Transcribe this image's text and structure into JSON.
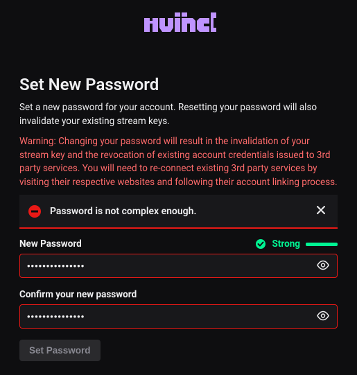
{
  "brand": "twitch",
  "page_title": "Set New Password",
  "description": "Set a new password for your account. Resetting your password will also invalidate your existing stream keys.",
  "warning": "Warning: Changing your password will result in the invalidation of your stream key and the revocation of existing account credentials issued to 3rd party services. You will need to re-connect existing 3rd party services by visiting their respective websites and following their account linking process.",
  "alert": {
    "message": "Password is not complex enough."
  },
  "fields": {
    "new_password": {
      "label": "New Password",
      "value": "•••••••••••••••",
      "strength_label": "Strong"
    },
    "confirm_password": {
      "label": "Confirm your new password",
      "value": "•••••••••••••••"
    }
  },
  "submit_label": "Set Password",
  "colors": {
    "brand": "#bf94ff",
    "error": "#e91916",
    "success": "#00f593"
  }
}
